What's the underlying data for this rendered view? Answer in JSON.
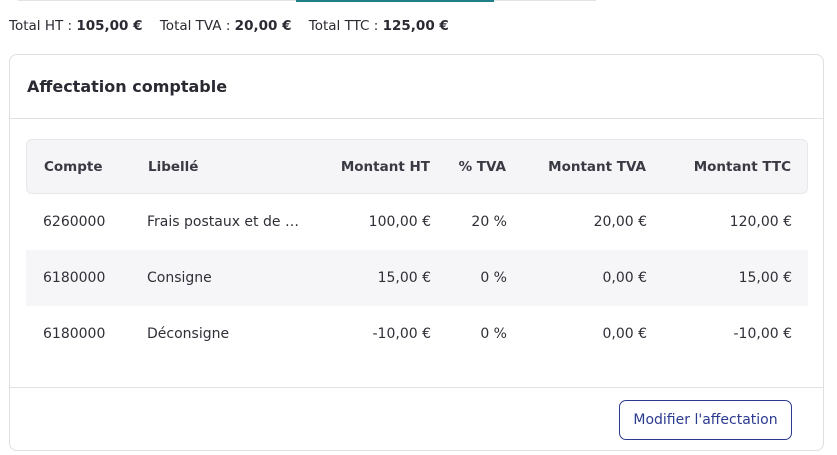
{
  "totals": {
    "ht_label": "Total HT :",
    "ht_value": "105,00 €",
    "tva_label": "Total TVA :",
    "tva_value": "20,00 €",
    "ttc_label": "Total TTC :",
    "ttc_value": "125,00 €"
  },
  "card": {
    "title": "Affectation comptable",
    "button_label": "Modifier l'affectation"
  },
  "table": {
    "headers": {
      "compte": "Compte",
      "libelle": "Libellé",
      "montant_ht": "Montant HT",
      "tva": "% TVA",
      "montant_tva": "Montant TVA",
      "montant_ttc": "Montant TTC"
    },
    "rows": [
      {
        "compte": "6260000",
        "libelle": "Frais postaux et de té...",
        "montant_ht": "100,00 €",
        "tva": "20 %",
        "montant_tva": "20,00 €",
        "montant_ttc": "120,00 €"
      },
      {
        "compte": "6180000",
        "libelle": "Consigne",
        "montant_ht": "15,00 €",
        "tva": "0 %",
        "montant_tva": "0,00 €",
        "montant_ttc": "15,00 €"
      },
      {
        "compte": "6180000",
        "libelle": "Déconsigne",
        "montant_ht": "-10,00 €",
        "tva": "0 %",
        "montant_tva": "0,00 €",
        "montant_ttc": "-10,00 €"
      }
    ]
  }
}
